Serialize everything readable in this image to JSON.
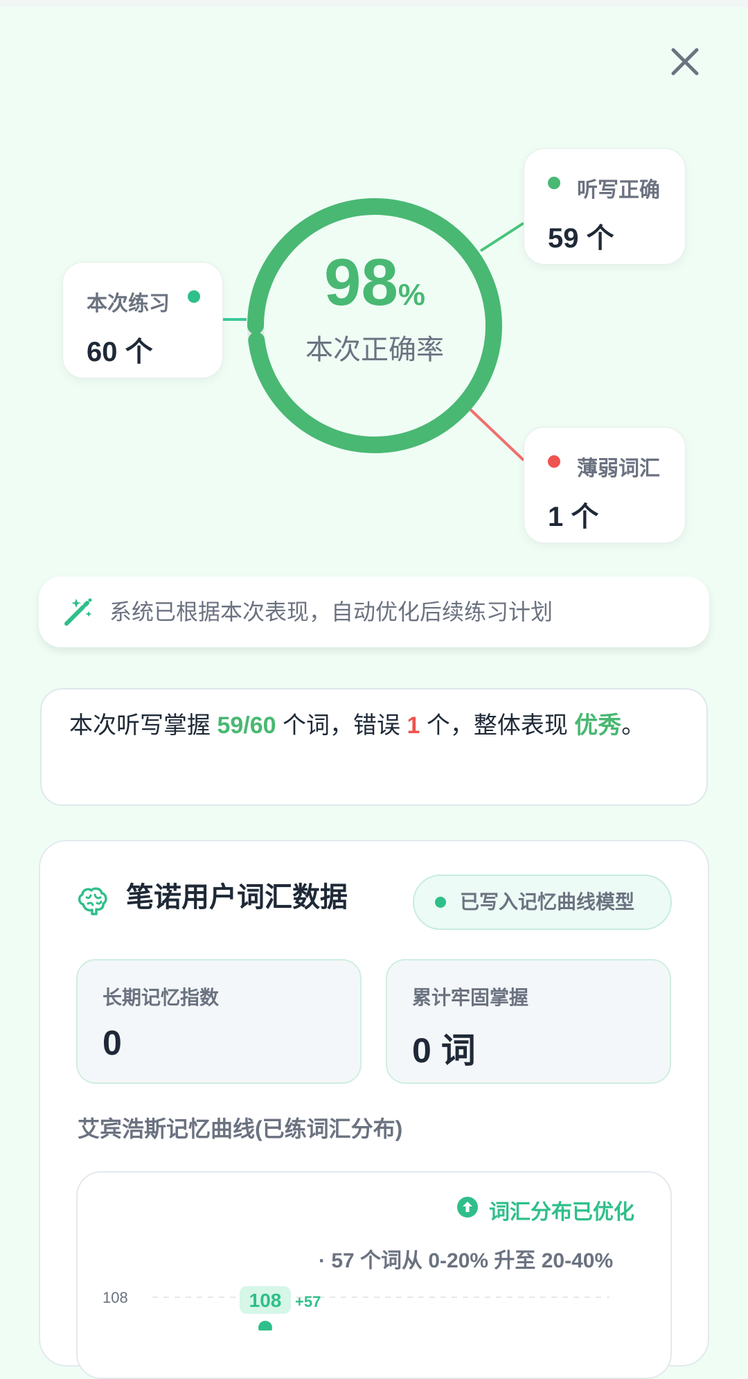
{
  "close_icon": "close-icon",
  "ring": {
    "percent_value": "98",
    "percent_sign": "%",
    "label": "本次正确率",
    "fraction": 0.98,
    "color": "#49b873"
  },
  "stats": {
    "practice": {
      "label": "本次练习",
      "value": "60 个",
      "dot_color": "#2fbf8a"
    },
    "correct": {
      "label": "听写正确",
      "value": "59 个",
      "dot_color": "#49b873"
    },
    "weak": {
      "label": "薄弱词汇",
      "value": "1 个",
      "dot_color": "#ef5350"
    }
  },
  "banner": {
    "icon": "magic-wand-icon",
    "text": "系统已根据本次表现，自动优化后续练习计划"
  },
  "summary": {
    "prefix": "本次听写掌握 ",
    "mastered": "59/60",
    "mid1": " 个词，错误 ",
    "errors": "1",
    "mid2": " 个，整体表现 ",
    "grade": "优秀",
    "suffix": "。"
  },
  "panel": {
    "icon": "brain-icon",
    "title": "笔诺用户词汇数据",
    "badge": "已写入记忆曲线模型",
    "metrics": [
      {
        "label": "长期记忆指数",
        "value": "0"
      },
      {
        "label": "累计牢固掌握",
        "value": "0 词"
      }
    ],
    "curve_title": "艾宾浩斯记忆曲线(已练词汇分布)",
    "optimized_label": "词汇分布已优化",
    "shift_note": "· 57 个词从 0-20% 升至 20-40%"
  },
  "chart_data": {
    "type": "line",
    "y_tick_labels": [
      "108"
    ],
    "points": [
      {
        "label": "108",
        "value": 108,
        "delta": "+57"
      }
    ]
  }
}
